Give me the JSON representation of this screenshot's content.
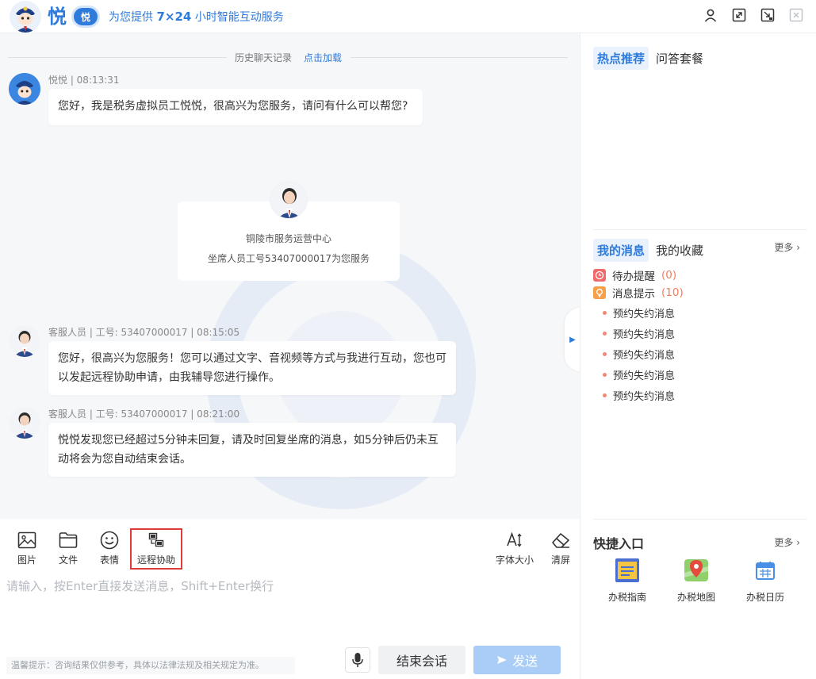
{
  "header": {
    "brand": "悦",
    "brand_badge": "悦",
    "slogan_prefix": "为您提供",
    "slogan_bold": "7×24",
    "slogan_suffix": "小时智能互动服务",
    "icons": [
      "user-icon",
      "fullscreen-icon",
      "exit-icon",
      "close-icon"
    ]
  },
  "chat": {
    "history_label": "历史聊天记录",
    "history_link": "点击加载",
    "bot_meta": "悦悦 | 08:13:31",
    "bot_message": "您好，我是税务虚拟员工悦悦，很高兴为您服务，请问有什么可以帮您?",
    "agent_card_org": "铜陵市服务运营中心",
    "agent_card_id": "坐席人员工号53407000017为您服务",
    "msg1_meta": "客服人员 | 工号: 53407000017 | 08:15:05",
    "msg1_line1": "您好，很高兴为您服务！您可以通过文字、音视频等方式与我进行互动，您也可",
    "msg1_line2": "以发起远程协助申请，由我辅导您进行操作。",
    "msg2_meta": "客服人员 | 工号: 53407000017 | 08:21:00",
    "msg2_line1": "悦悦发现您已经超过5分钟未回复，请及时回复坐席的消息，如5分钟后仍未互",
    "msg2_line2": "动将会为您自动结束会话。"
  },
  "toolbar": {
    "image": "图片",
    "file": "文件",
    "emoji": "表情",
    "remote": "远程协助",
    "font_size": "字体大小",
    "clear": "清屏"
  },
  "input": {
    "placeholder": "请输入，按Enter直接发送消息，Shift+Enter换行",
    "tip": "温馨提示：咨询结果仅供参考，具体以法律法规及相关规定为准。",
    "end_button": "结束会话",
    "send_button": "发送"
  },
  "sidebar": {
    "tab_hot": "热点推荐",
    "tab_qa": "问答套餐",
    "tab_my_msg": "我的消息",
    "tab_fav": "我的收藏",
    "more": "更多",
    "todo_label": "待办提醒",
    "todo_count": "(0)",
    "notice_label": "消息提示",
    "notice_count": "(10)",
    "messages": [
      "预约失约消息",
      "预约失约消息",
      "预约失约消息",
      "预约失约消息",
      "预约失约消息"
    ],
    "quick_title": "快捷入口",
    "quick_more": "更多",
    "quick_items": [
      "办税指南",
      "办税地图",
      "办税日历"
    ],
    "quick_icon_text": "办税\n指南"
  },
  "colors": {
    "accent": "#2f7bdc",
    "highlight_box": "#e03b3b",
    "send_disabled": "#a9cdf7",
    "count": "#f47c5c"
  }
}
